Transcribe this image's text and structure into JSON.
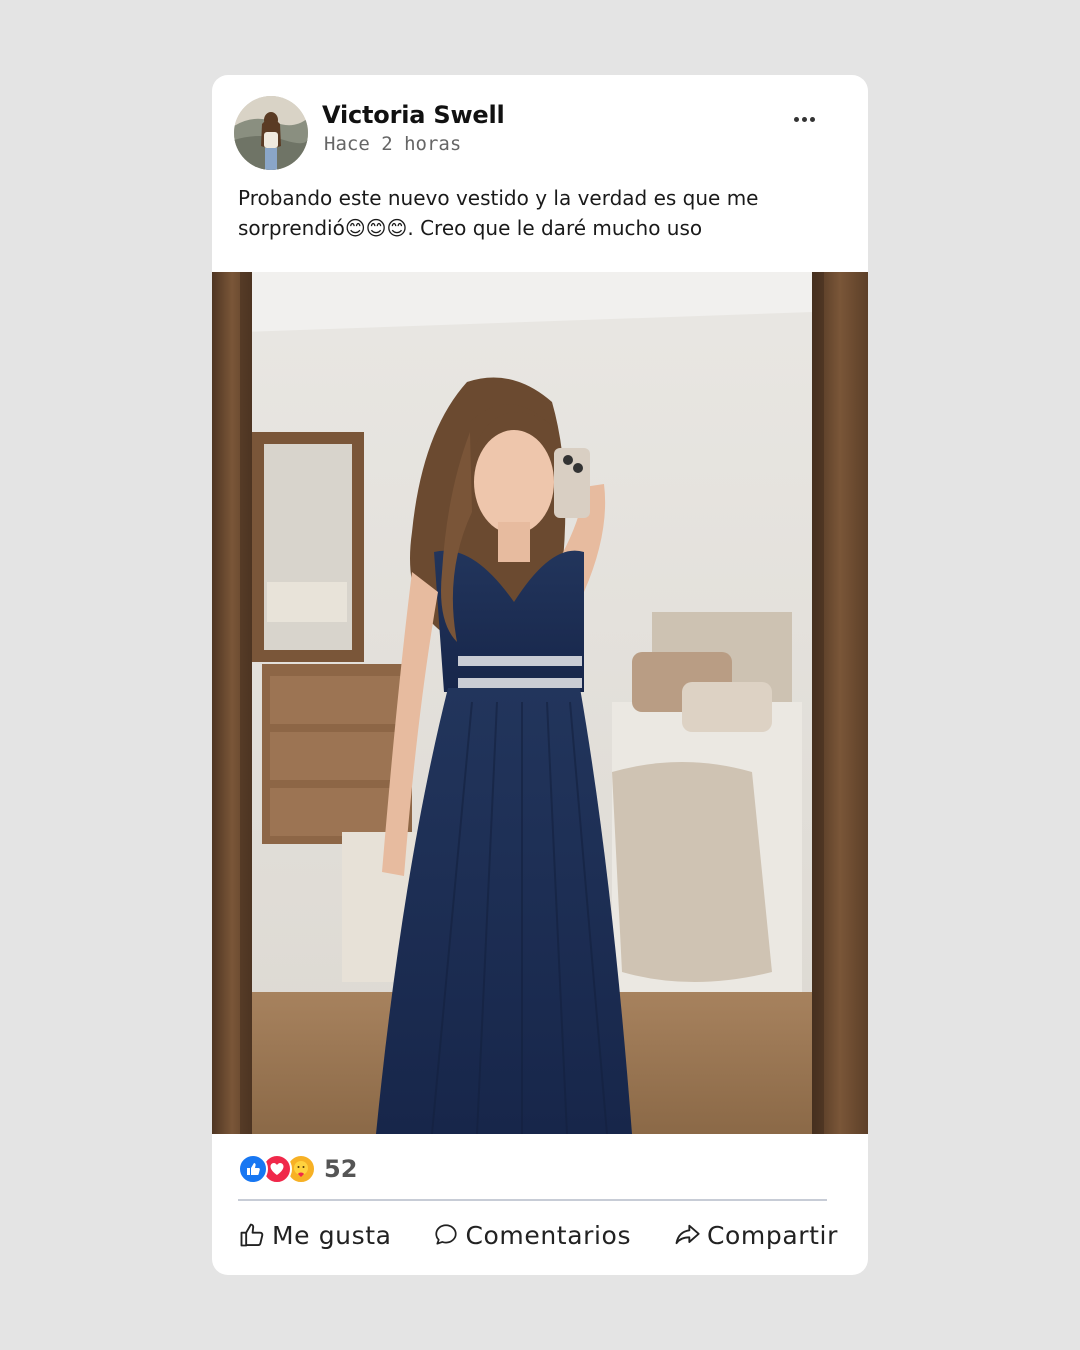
{
  "post": {
    "author": "Victoria Swell",
    "time": "Hace 2 horas",
    "caption": "Probando este nuevo vestido y la verdad es que me sorprendió😊😊😊. Creo que le daré mucho uso",
    "reaction_count": "52",
    "reaction_icons": [
      "like-icon",
      "love-icon",
      "care-icon"
    ]
  },
  "actions": {
    "like": "Me gusta",
    "comment": "Comentarios",
    "share": "Compartir"
  },
  "colors": {
    "background": "#e4e4e4",
    "card": "#ffffff",
    "like": "#1877f2",
    "love": "#f0284a",
    "care": "#f7b125",
    "dress": "#1c2e52",
    "mirror_frame": "#6e4d33"
  }
}
